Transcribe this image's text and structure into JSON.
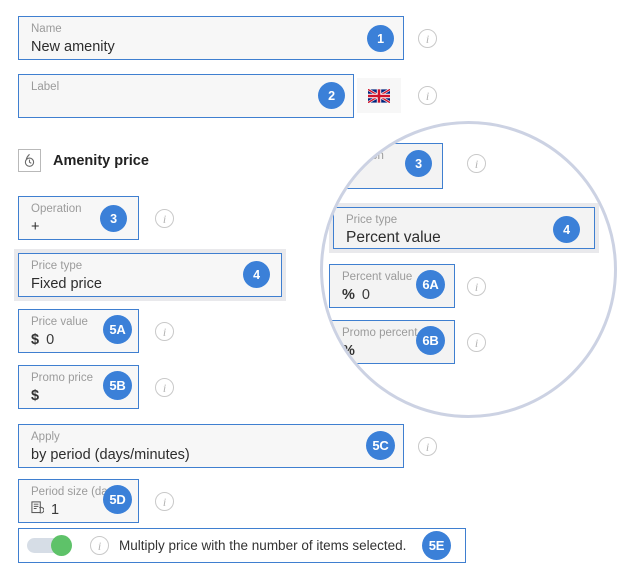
{
  "form": {
    "name_field": {
      "label": "Name",
      "value": "New amenity",
      "badge": "1"
    },
    "label_field": {
      "label": "Label",
      "value": "",
      "badge": "2",
      "flag_icon": "uk-flag-icon"
    },
    "section": {
      "icon": "price-tag-icon",
      "title": "Amenity price"
    },
    "operation_field": {
      "label": "Operation",
      "value": "+",
      "badge": "3"
    },
    "price_type_field": {
      "label": "Price type",
      "value": "Fixed price",
      "badge": "4"
    },
    "price_value_field": {
      "label": "Price value",
      "unit": "$",
      "value": "0",
      "badge": "5A"
    },
    "promo_price_field": {
      "label": "Promo price",
      "unit": "$",
      "value": "",
      "badge": "5B"
    },
    "apply_field": {
      "label": "Apply",
      "value": "by period (days/minutes)",
      "badge": "5C"
    },
    "period_size_field": {
      "label": "Period size (days)",
      "icon": "calendar-clock-icon",
      "value": "1",
      "badge": "5D"
    },
    "multiply_toggle": {
      "text": "Multiply price with the number of items selected.",
      "badge": "5E",
      "state": "on"
    }
  },
  "magnifier": {
    "operation_field": {
      "label": "ation",
      "value": "",
      "badge": "3"
    },
    "price_type_field": {
      "label": "Price type",
      "value": "Percent value",
      "badge": "4"
    },
    "percent_value_field": {
      "label": "Percent value",
      "unit": "%",
      "value": "0",
      "badge": "6A"
    },
    "promo_percent_field": {
      "label": "Promo percent",
      "unit": "%",
      "value": "",
      "badge": "6B"
    }
  },
  "icons": {
    "info": "i"
  },
  "colors": {
    "badge_blue": "#3b80d8",
    "field_border": "#3f7fd0",
    "field_bg": "#f7f7f7",
    "toggle_on_green": "#5ec269",
    "magnifier_ring": "#ccd2e3"
  }
}
